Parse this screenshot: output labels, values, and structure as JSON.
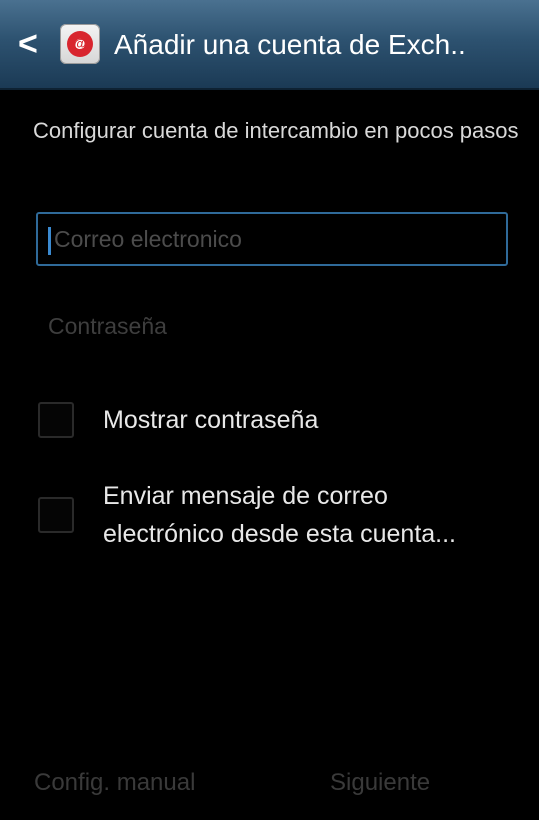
{
  "header": {
    "back_glyph": "<",
    "app_icon": "email-app-icon",
    "app_icon_glyph": "@",
    "title": "Añadir una cuenta de Exch.."
  },
  "intro": "Configurar cuenta de intercambio en pocos pasos",
  "email": {
    "placeholder": "Correo electronico"
  },
  "password": {
    "placeholder": "Contraseña"
  },
  "checkboxes": [
    {
      "label": "Mostrar contraseña",
      "checked": false
    },
    {
      "label_line1": "Enviar mensaje de correo",
      "label_line2": "electrónico desde esta cuenta...",
      "checked": false
    }
  ],
  "footer": {
    "manual_label": "Config. manual",
    "next_label": "Siguiente"
  },
  "colors": {
    "header_bg": "#2d5270",
    "background": "#000000",
    "focus_border": "#2f6a99",
    "disabled_text": "#3a3a3a"
  }
}
